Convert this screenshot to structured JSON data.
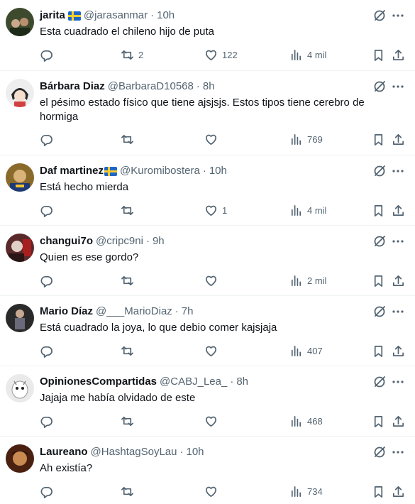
{
  "tweets": [
    {
      "name": "jarita",
      "flag": true,
      "handle": "@jarasanmar",
      "time": "10h",
      "text": "Esta cuadrado el chileno hijo de puta",
      "replies": "",
      "retweets": "2",
      "likes": "122",
      "views": "4 mil",
      "avatar_color": "#3d4a2e"
    },
    {
      "name": "Bárbara Diaz",
      "flag": false,
      "handle": "@BarbaraD10568",
      "time": "8h",
      "text": "el pésimo estado físico que tiene ajsjsjs. Estos tipos tiene cerebro de hormiga",
      "replies": "",
      "retweets": "",
      "likes": "",
      "views": "769",
      "avatar_color": "#e8e8e8"
    },
    {
      "name": "Daf martinez",
      "flag": true,
      "handle": "@Kuromibostera",
      "time": "10h",
      "text": "Está hecho mierda",
      "replies": "",
      "retweets": "",
      "likes": "1",
      "views": "4 mil",
      "avatar_color": "#8a6a2a"
    },
    {
      "name": "changui7o",
      "flag": false,
      "handle": "@cripc9ni",
      "time": "9h",
      "text": "Quien es ese gordo?",
      "replies": "",
      "retweets": "",
      "likes": "",
      "views": "2 mil",
      "avatar_color": "#5a2a2a"
    },
    {
      "name": "Mario Díaz",
      "flag": false,
      "handle": "@___MarioDiaz",
      "time": "7h",
      "text": "Está cuadrado la joya, lo que debio comer kajsjaja",
      "replies": "",
      "retweets": "",
      "likes": "",
      "views": "407",
      "avatar_color": "#2a2a2a"
    },
    {
      "name": "OpinionesCompartidas",
      "flag": false,
      "handle": "@CABJ_Lea_",
      "time": "8h",
      "text": "Jajaja me había olvidado de este",
      "replies": "",
      "retweets": "",
      "likes": "",
      "views": "468",
      "avatar_color": "#d8d8d8"
    },
    {
      "name": "Laureano",
      "flag": false,
      "handle": "@HashtagSoyLau",
      "time": "10h",
      "text": "Ah existía?",
      "replies": "",
      "retweets": "",
      "likes": "",
      "views": "734",
      "avatar_color": "#4a2010"
    }
  ],
  "icons": {
    "reply": "reply-icon",
    "retweet": "retweet-icon",
    "like": "like-icon",
    "views": "views-icon",
    "bookmark": "bookmark-icon",
    "share": "share-icon",
    "grok": "grok-icon",
    "more": "more-icon"
  }
}
